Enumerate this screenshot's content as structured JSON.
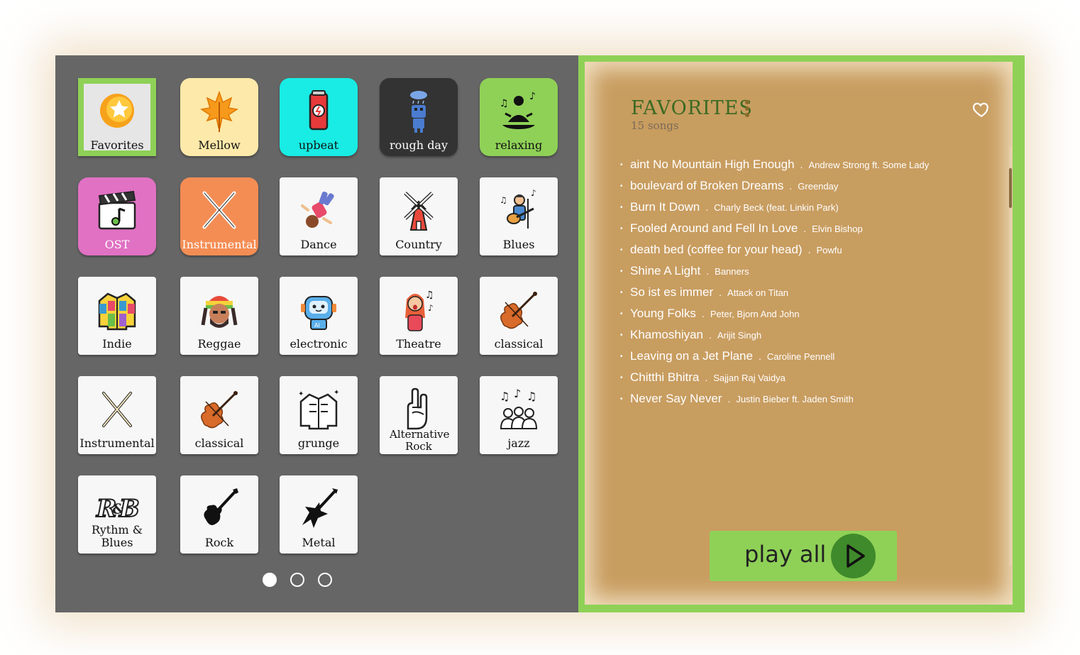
{
  "categories": [
    {
      "label": "Favorites",
      "icon": "star-badge-icon",
      "bg": "#e6e6e6",
      "selected": true
    },
    {
      "label": "Mellow",
      "icon": "maple-leaf-icon",
      "bg": "#fde9a9"
    },
    {
      "label": "upbeat",
      "icon": "energy-drink-can-icon",
      "bg": "#18ece4"
    },
    {
      "label": "rough day",
      "icon": "rainy-robot-icon",
      "bg": "#333333",
      "color": "#ffffff"
    },
    {
      "label": "relaxing",
      "icon": "meditation-music-icon",
      "bg": "#8fd157"
    },
    {
      "label": "OST",
      "icon": "clapperboard-note-icon",
      "bg": "#e071c3",
      "color": "#ffffff"
    },
    {
      "label": "Instrumental",
      "icon": "crossed-drumsticks-icon",
      "bg": "#f48d54",
      "color": "#ffffff"
    },
    {
      "label": "Dance",
      "icon": "breakdancer-icon",
      "bg": "#f7f7f7"
    },
    {
      "label": "Country",
      "icon": "windmill-icon",
      "bg": "#f7f7f7"
    },
    {
      "label": "Blues",
      "icon": "guitarist-singer-icon",
      "bg": "#f7f7f7"
    },
    {
      "label": "Indie",
      "icon": "patchwork-jacket-icon",
      "bg": "#f7f7f7"
    },
    {
      "label": "Reggae",
      "icon": "rasta-man-icon",
      "bg": "#f7f7f7"
    },
    {
      "label": "electronic",
      "icon": "ai-robot-icon",
      "bg": "#f7f7f7"
    },
    {
      "label": "Theatre",
      "icon": "singer-girl-icon",
      "bg": "#f7f7f7"
    },
    {
      "label": "classical",
      "icon": "violin-icon",
      "bg": "#f7f7f7"
    },
    {
      "label": "Instrumental",
      "icon": "drumsticks-outline-icon",
      "bg": "#f7f7f7"
    },
    {
      "label": "classical",
      "icon": "violin-icon",
      "bg": "#f7f7f7"
    },
    {
      "label": "grunge",
      "icon": "denim-jacket-icon",
      "bg": "#f7f7f7"
    },
    {
      "label": "Alternative Rock",
      "icon": "rock-hand-icon",
      "bg": "#f7f7f7"
    },
    {
      "label": "jazz",
      "icon": "choir-notes-icon",
      "bg": "#f7f7f7"
    },
    {
      "label": "Rythm & Blues",
      "icon": "rnb-logo-icon",
      "bg": "#f7f7f7"
    },
    {
      "label": "Rock",
      "icon": "electric-guitar-icon",
      "bg": "#f7f7f7"
    },
    {
      "label": "Metal",
      "icon": "metal-guitar-icon",
      "bg": "#f7f7f7"
    }
  ],
  "pager": {
    "pages": 3,
    "current": 1
  },
  "playlist": {
    "title": "FAVORITES",
    "count_label": "15 songs",
    "songs": [
      {
        "title": "aint No Mountain High Enough",
        "artist": "Andrew Strong ft. Some Lady"
      },
      {
        "title": "boulevard of Broken Dreams",
        "artist": "Greenday"
      },
      {
        "title": "Burn It Down",
        "artist": "Charly Beck (feat. Linkin Park)"
      },
      {
        "title": "Fooled Around and Fell In Love",
        "artist": "Elvin Bishop"
      },
      {
        "title": "death bed (coffee for your head)",
        "artist": "Powfu"
      },
      {
        "title": "Shine A Light",
        "artist": "Banners"
      },
      {
        "title": "So ist es immer",
        "artist": "Attack on Titan"
      },
      {
        "title": "Young Folks",
        "artist": "Peter, Bjorn And John"
      },
      {
        "title": "Khamoshiyan",
        "artist": "Arijit Singh"
      },
      {
        "title": "Leaving on a Jet Plane",
        "artist": "Caroline Pennell"
      },
      {
        "title": "Chitthi Bhitra",
        "artist": "Sajjan Raj Vaidya"
      },
      {
        "title": "Never Say Never",
        "artist": "Justin Bieber ft. Jaden Smith"
      }
    ],
    "play_all_label": "play all"
  },
  "colors": {
    "accent": "#8fd157",
    "panel": "#c89d60",
    "grid_bg": "#666666",
    "title": "#3a6a22"
  }
}
